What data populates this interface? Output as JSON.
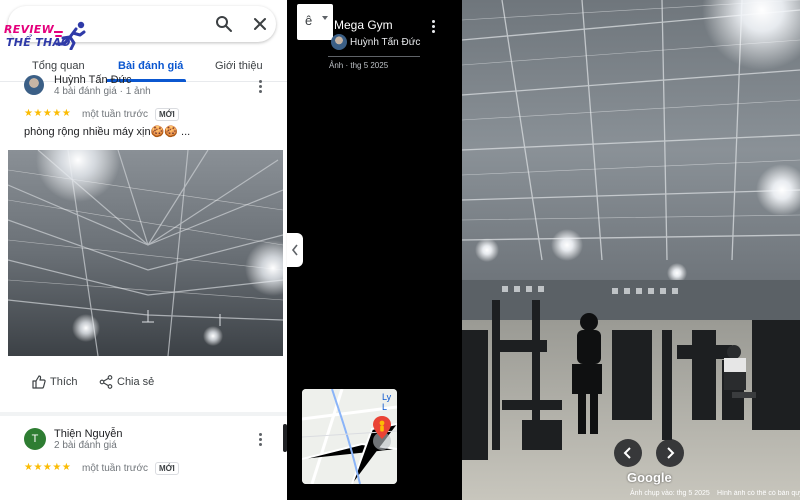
{
  "logo": {
    "line1": "REVIEW",
    "line2": "THỂ THAO"
  },
  "tabs": [
    {
      "label": "Tổng quan"
    },
    {
      "label": "Bài đánh giá"
    },
    {
      "label": "Giới thiệu"
    }
  ],
  "reviews": [
    {
      "author": "Huỳnh Tấn Đức",
      "meta": "4 bài đánh giá · 1 ảnh",
      "stars": "★★★★★",
      "rating": 5,
      "time": "một tuần trước",
      "badge": "MỚI",
      "text": "phòng rộng nhiều máy xịn🍪🍪 ..."
    },
    {
      "author": "Thiện Nguyễn",
      "avatar_letter": "T",
      "meta": "2 bài đánh giá",
      "stars": "★★★★★",
      "rating": 5,
      "time": "một tuần trước",
      "badge": "MỚI"
    }
  ],
  "actions": {
    "like": "Thích",
    "share": "Chia sẻ"
  },
  "viewer": {
    "lang_glyph": "ê",
    "place_title": "Mega Gym",
    "contributor": "Huỳnh Tấn Đức",
    "photo_date": "Ảnh · thg 5 2025",
    "minimap_label": "Ly L"
  },
  "footer": {
    "google": "Google",
    "capture_date": "Ảnh chụp vào: thg 5 2025",
    "copyright": "Hình ảnh có thể có bản quyền"
  },
  "colors": {
    "accent_blue": "#0b57d0",
    "star_yellow": "#fbbc04",
    "viewer_bg": "#000000",
    "logo_pink": "#e4007c",
    "logo_blue": "#2f3aa8",
    "avatar_green": "#2e7d32"
  },
  "icons": [
    "search-icon",
    "close-icon",
    "more-vert-icon",
    "thumb-up-icon",
    "share-icon",
    "chevron-left-icon",
    "chevron-right-icon",
    "dropdown-caret-icon",
    "map-pin-icon"
  ]
}
